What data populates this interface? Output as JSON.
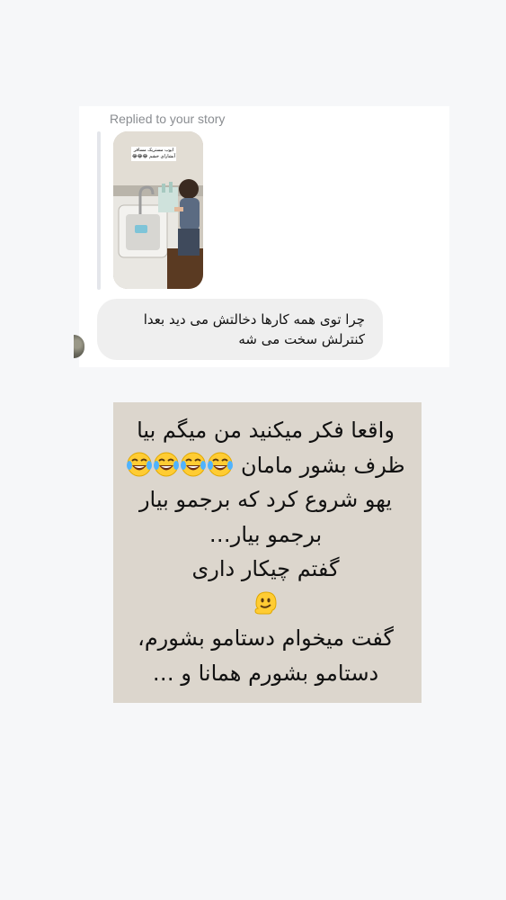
{
  "reply": {
    "label": "Replied to your story",
    "story_caption": "ایوب مستریک مسافر آبشارای خشم 😂😂😂"
  },
  "message": {
    "line1": "چرا توی همه کارها دخالتش می دید  بعدا",
    "line2": "کنترلش سخت می شه"
  },
  "note": {
    "line1": "واقعا فکر میکنید من میگم بیا",
    "line2": "ظرف بشور مامان",
    "line2_emoji": "face-with-tears-of-joy",
    "line2_emoji_count": 4,
    "line3": "یهو شروع کرد که برجمو بیار",
    "line4": "برجمو بیار…",
    "line5": "گفتم چیکار داری",
    "line6_emoji": "melting-face",
    "line7": "گفت میخوام دستامو بشورم،",
    "line8": "دستامو بشورم همانا و …"
  },
  "colors": {
    "page_bg": "#f6f7f9",
    "bubble_bg": "#efefef",
    "note_bg": "#dcd6cd",
    "label_gray": "#8a8d91"
  }
}
